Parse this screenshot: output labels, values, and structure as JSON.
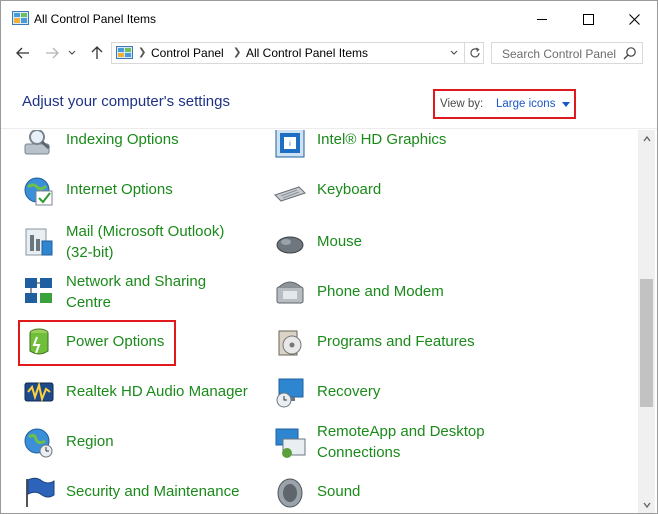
{
  "window": {
    "title": "All Control Panel Items"
  },
  "address": {
    "crumbs": [
      "Control Panel",
      "All Control Panel Items"
    ],
    "search_placeholder": "Search Control Panel"
  },
  "header": {
    "heading": "Adjust your computer's settings",
    "view_by_label": "View by:",
    "view_by_value": "Large icons"
  },
  "items_left": [
    {
      "label": "Indexing Options",
      "icon": "indexing-options-icon"
    },
    {
      "label": "Internet Options",
      "icon": "internet-options-icon"
    },
    {
      "label_line1": "Mail (Microsoft Outlook)",
      "label_line2": "(32-bit)",
      "icon": "mail-icon"
    },
    {
      "label_line1": "Network and Sharing",
      "label_line2": "Centre",
      "icon": "network-sharing-icon"
    },
    {
      "label": "Power Options",
      "icon": "power-options-icon"
    },
    {
      "label": "Realtek HD Audio Manager",
      "icon": "realtek-audio-icon"
    },
    {
      "label": "Region",
      "icon": "region-icon"
    },
    {
      "label": "Security and Maintenance",
      "icon": "security-maintenance-icon"
    }
  ],
  "items_right": [
    {
      "label": "Intel® HD Graphics",
      "icon": "intel-graphics-icon"
    },
    {
      "label": "Keyboard",
      "icon": "keyboard-icon"
    },
    {
      "label": "Mouse",
      "icon": "mouse-icon"
    },
    {
      "label": "Phone and Modem",
      "icon": "phone-modem-icon"
    },
    {
      "label": "Programs and Features",
      "icon": "programs-features-icon"
    },
    {
      "label": "Recovery",
      "icon": "recovery-icon"
    },
    {
      "label_line1": "RemoteApp and Desktop",
      "label_line2": "Connections",
      "icon": "remoteapp-icon"
    },
    {
      "label": "Sound",
      "icon": "sound-icon"
    }
  ],
  "colors": {
    "link_green": "#1a8a1a",
    "heading_blue": "#1e3287",
    "highlight_red": "#e0191c"
  }
}
